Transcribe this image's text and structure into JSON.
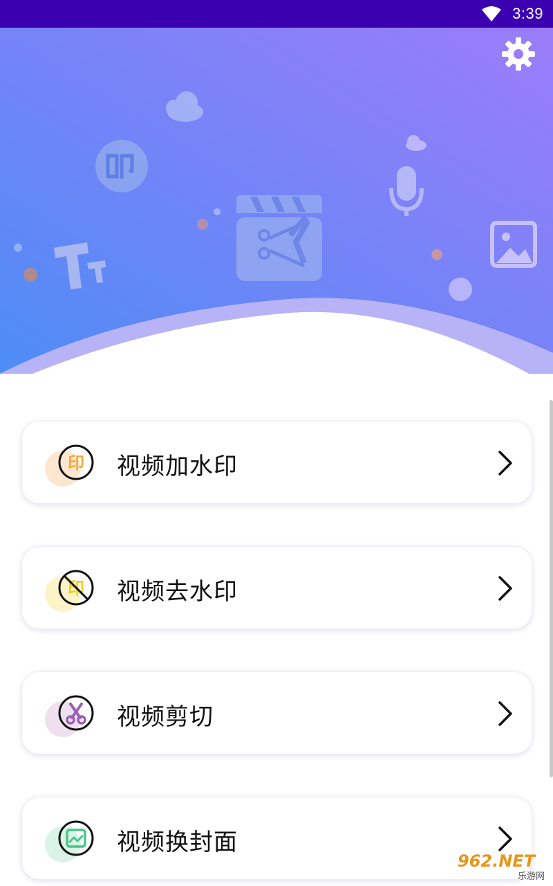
{
  "status_bar": {
    "time": "3:39",
    "wifi_icon": "wifi-icon"
  },
  "header": {
    "settings_icon": "gear-icon"
  },
  "banner": {
    "illustration_icons": [
      "cloud-icon",
      "watermark-stamp-icon",
      "text-size-icon",
      "video-clip-icon",
      "microphone-icon",
      "image-icon"
    ],
    "stamp_text": "印"
  },
  "menu": {
    "items": [
      {
        "label": "视频加水印",
        "icon": "add-watermark-icon",
        "icon_text": "印",
        "accent": "#f2a93b",
        "blob": "#fbe7cf"
      },
      {
        "label": "视频去水印",
        "icon": "remove-watermark-icon",
        "icon_text": "印",
        "accent": "#f2cf1d",
        "blob": "#fbf4c8"
      },
      {
        "label": "视频剪切",
        "icon": "scissors-icon",
        "icon_text": "",
        "accent": "#9b5fb4",
        "blob": "#efe0ef"
      },
      {
        "label": "视频换封面",
        "icon": "image-cover-icon",
        "icon_text": "",
        "accent": "#48c488",
        "blob": "#d9f3e6"
      }
    ],
    "chevron_icon": "chevron-right-icon"
  },
  "watermark": {
    "brand": "962.NET",
    "sub": "乐游网"
  },
  "colors": {
    "status_bar": "#3b00b0",
    "gradient_start": "#4f8cf5",
    "gradient_end": "#9b7bf9"
  }
}
